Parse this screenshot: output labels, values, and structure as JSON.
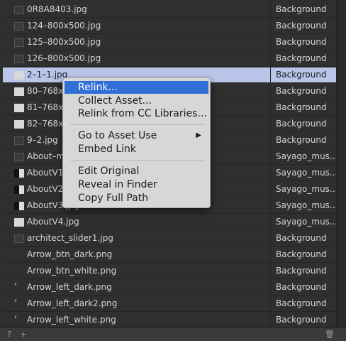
{
  "rows": [
    {
      "name": "0R8A8403.jpg",
      "layer": "Background",
      "thumb": "dark"
    },
    {
      "name": "124–800x500.jpg",
      "layer": "Background",
      "thumb": "dark"
    },
    {
      "name": "125–800x500.jpg",
      "layer": "Background",
      "thumb": "dark"
    },
    {
      "name": "126–800x500.jpg",
      "layer": "Background",
      "thumb": "dark"
    },
    {
      "name": "2–1–1.jpg",
      "layer": "Background",
      "thumb": "light",
      "selected": true
    },
    {
      "name": "80–768x6",
      "layer": "Background",
      "thumb": "light"
    },
    {
      "name": "81–768x6",
      "layer": "Background",
      "thumb": "light"
    },
    {
      "name": "82–768x6",
      "layer": "Background",
      "thumb": "light"
    },
    {
      "name": "9–2.jpg",
      "layer": "Background",
      "thumb": "dark"
    },
    {
      "name": "About–m",
      "layer": "Sayago_mus...",
      "thumb": "dark"
    },
    {
      "name": "AboutV1.",
      "layer": "Sayago_mus...",
      "thumb": "mix"
    },
    {
      "name": "AboutV2.",
      "layer": "Sayago_mus...",
      "thumb": "mix"
    },
    {
      "name": "AboutV3.jpg",
      "layer": "Sayago_mus...",
      "thumb": "mix"
    },
    {
      "name": "AboutV4.jpg",
      "layer": "Sayago_mus...",
      "thumb": "light"
    },
    {
      "name": "architect_slider1.jpg",
      "layer": "Background",
      "thumb": "dark"
    },
    {
      "name": "Arrow_btn_dark.png",
      "layer": "Background",
      "thumb": "none"
    },
    {
      "name": "Arrow_btn_white.png",
      "layer": "Background",
      "thumb": "none"
    },
    {
      "name": "Arrow_left_dark.png",
      "layer": "Background",
      "thumb": "arrow"
    },
    {
      "name": "Arrow_left_dark2.png",
      "layer": "Background",
      "thumb": "arrow"
    },
    {
      "name": "Arrow_left_white.png",
      "layer": "Background",
      "thumb": "arrow"
    }
  ],
  "context_menu": {
    "relink": "Relink...",
    "collect_asset": "Collect Asset...",
    "relink_cc": "Relink from CC Libraries...",
    "go_to_asset_use": "Go to Asset Use",
    "submenu_arrow": "▶",
    "embed_link": "Embed Link",
    "edit_original": "Edit Original",
    "reveal_in_finder": "Reveal in Finder",
    "copy_full_path": "Copy Full Path"
  },
  "bottom": {
    "help_icon": "?",
    "new_icon": "+",
    "trash_icon": "🗑"
  },
  "colors": {
    "selection": "#b9c6e9",
    "menu_highlight": "#2f6fd6"
  }
}
